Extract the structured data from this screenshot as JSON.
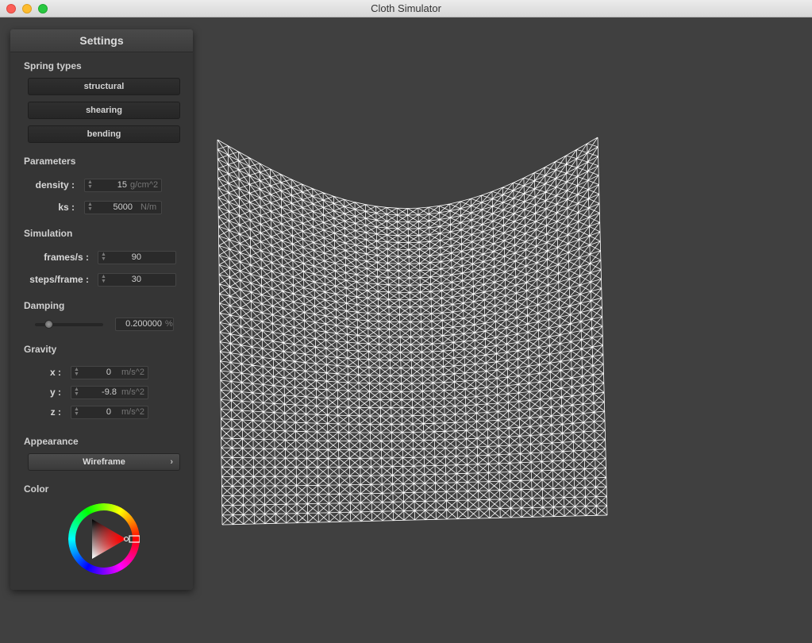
{
  "window": {
    "title": "Cloth Simulator"
  },
  "panel": {
    "title": "Settings",
    "spring_types": {
      "heading": "Spring types",
      "buttons": [
        "structural",
        "shearing",
        "bending"
      ]
    },
    "parameters": {
      "heading": "Parameters",
      "density": {
        "label": "density :",
        "value": "15",
        "unit": "g/cm^2"
      },
      "ks": {
        "label": "ks :",
        "value": "5000",
        "unit": "N/m"
      }
    },
    "simulation": {
      "heading": "Simulation",
      "fps": {
        "label": "frames/s :",
        "value": "90"
      },
      "steps": {
        "label": "steps/frame :",
        "value": "30"
      }
    },
    "damping": {
      "heading": "Damping",
      "value": "0.200000",
      "unit": "%",
      "slider_fraction": 0.2
    },
    "gravity": {
      "heading": "Gravity",
      "x": {
        "label": "x :",
        "value": "0",
        "unit": "m/s^2"
      },
      "y": {
        "label": "y :",
        "value": "-9.8",
        "unit": "m/s^2"
      },
      "z": {
        "label": "z :",
        "value": "0",
        "unit": "m/s^2"
      }
    },
    "appearance": {
      "heading": "Appearance",
      "selected": "Wireframe"
    },
    "color": {
      "heading": "Color",
      "selected_hex": "#ff0000"
    }
  },
  "colors": {
    "background": "#404040",
    "mesh": "#ffffff"
  },
  "icons": {
    "chevron": "chevron-right-icon",
    "spinner": "spinner-arrows-icon"
  }
}
